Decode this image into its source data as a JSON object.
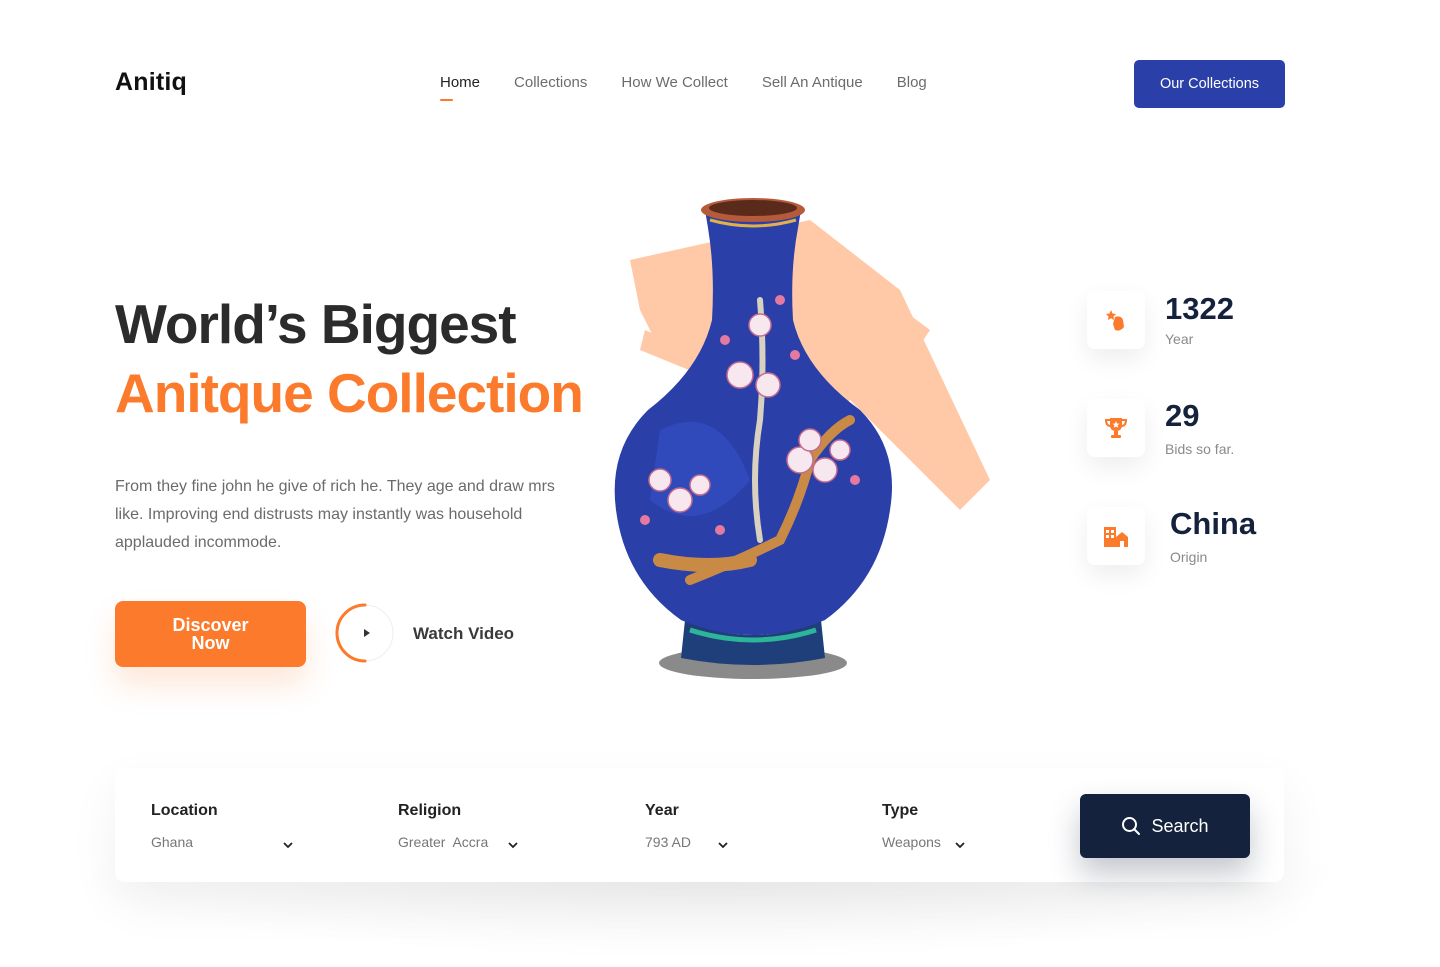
{
  "brand": {
    "logo": "Anitiq"
  },
  "nav": {
    "items": [
      {
        "label": "Home",
        "active": true
      },
      {
        "label": "Collections"
      },
      {
        "label": "How We Collect"
      },
      {
        "label": "Sell An Antique"
      },
      {
        "label": "Blog"
      }
    ],
    "cta_label": "Our Collections"
  },
  "hero": {
    "title_line1": "World’s Biggest",
    "title_line2": "Anitque Collection",
    "description": "From they fine john he give of rich he. They age and draw mrs like. Improving end distrusts may instantly was household applauded incommode.",
    "discover_label": "Discover Now",
    "watch_label": "Watch Video"
  },
  "stats": [
    {
      "value": "1322",
      "label": "Year",
      "icon": "hand-star-icon"
    },
    {
      "value": "29",
      "label": "Bids so far.",
      "icon": "trophy-icon"
    },
    {
      "value": "China",
      "label": "Origin",
      "icon": "buildings-icon"
    }
  ],
  "search": {
    "fields": [
      {
        "label": "Location",
        "value": "Ghana"
      },
      {
        "label": "Religion",
        "value": "Greater  Accra"
      },
      {
        "label": "Year",
        "value": "793 AD"
      },
      {
        "label": "Type",
        "value": "Weapons"
      }
    ],
    "button_label": "Search"
  },
  "colors": {
    "accent": "#fb7a2c",
    "primary": "#2b3fa9",
    "dark": "#14223d"
  }
}
